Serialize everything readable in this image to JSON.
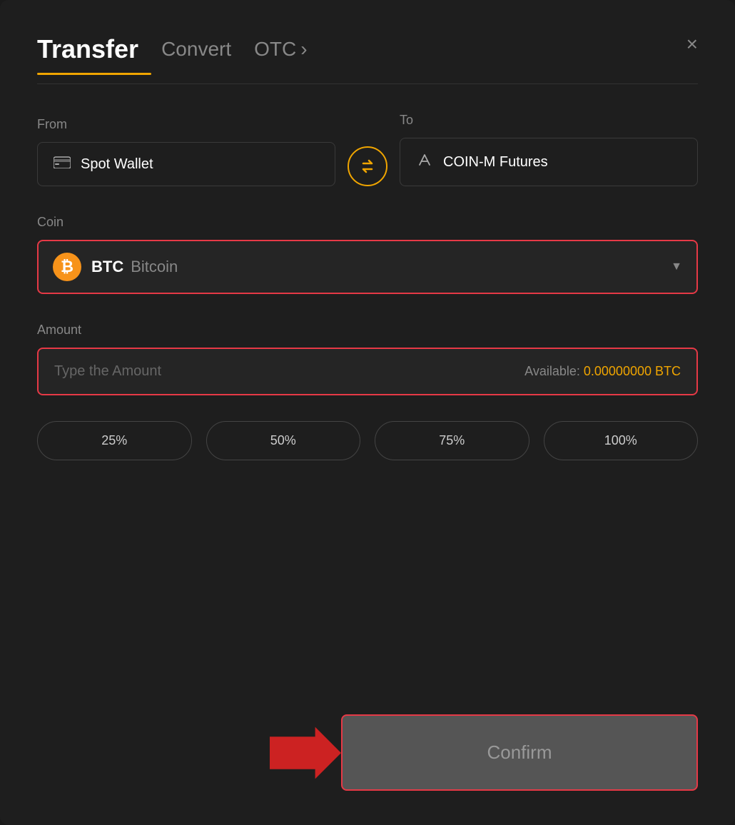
{
  "header": {
    "title": "Transfer",
    "tabs": [
      {
        "label": "Convert",
        "active": false
      },
      {
        "label": "OTC",
        "active": false,
        "arrow": true
      }
    ],
    "close_label": "×"
  },
  "from_section": {
    "label": "From",
    "wallet_icon": "▬",
    "wallet_name": "Spot Wallet"
  },
  "to_section": {
    "label": "To",
    "futures_icon": "↑",
    "futures_name": "COIN-M Futures"
  },
  "coin_section": {
    "label": "Coin",
    "coin_symbol": "BTC",
    "coin_name": "Bitcoin",
    "btc_symbol": "₿"
  },
  "amount_section": {
    "label": "Amount",
    "placeholder": "Type the Amount",
    "available_label": "Available:",
    "available_amount": "0.00000000 BTC"
  },
  "percent_buttons": [
    {
      "label": "25%"
    },
    {
      "label": "50%"
    },
    {
      "label": "75%"
    },
    {
      "label": "100%"
    }
  ],
  "confirm_button": {
    "label": "Confirm"
  },
  "colors": {
    "accent": "#f0a500",
    "highlight_border": "#e63946",
    "bg": "#1e1e1e"
  }
}
